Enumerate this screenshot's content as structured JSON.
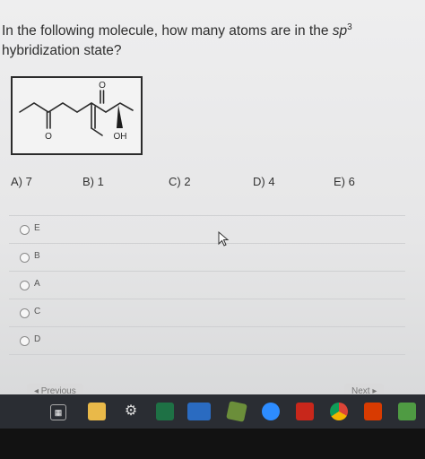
{
  "question": {
    "prefix": "In the following molecule, how many atoms are in the ",
    "sp": "sp",
    "sup": "3",
    "suffix": " hybridization state?"
  },
  "molecule": {
    "label_o1": "O",
    "label_o2": "O",
    "label_oh": "OH"
  },
  "choices": [
    "A) 7",
    "B) 1",
    "C) 2",
    "D) 4",
    "E) 6"
  ],
  "answers": [
    "E",
    "B",
    "A",
    "C",
    "D"
  ],
  "nav": {
    "previous": "◂ Previous",
    "next": "Next ▸"
  },
  "taskbar": {
    "icons": [
      "task-view-icon",
      "file-explorer-icon",
      "settings-icon",
      "excel-icon",
      "outlook-icon",
      "notes-icon",
      "zoom-icon",
      "acrobat-icon",
      "chrome-icon",
      "office-icon",
      "messages-icon"
    ]
  }
}
